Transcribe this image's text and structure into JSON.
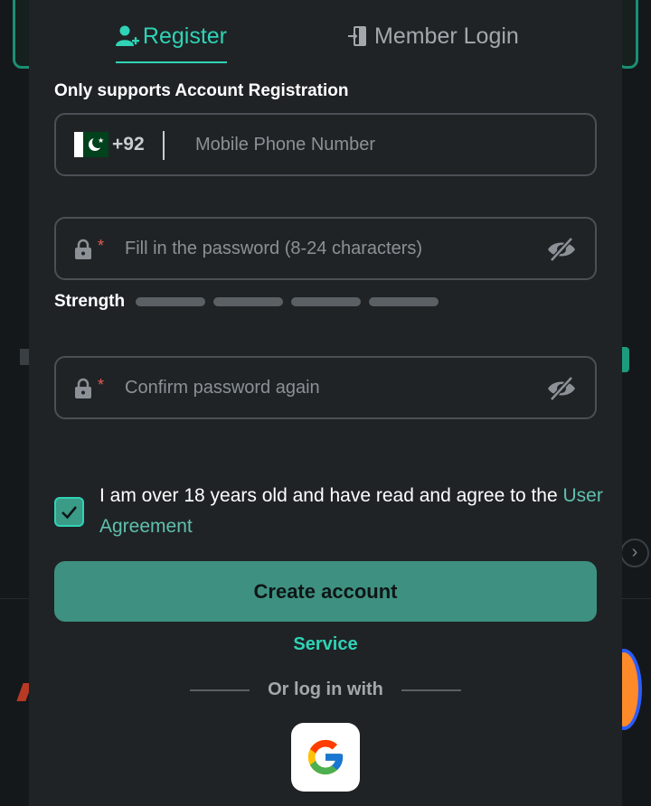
{
  "tabs": {
    "register": "Register",
    "login": "Member Login"
  },
  "note": "Only supports Account Registration",
  "phone": {
    "country_code": "+92",
    "placeholder": "Mobile Phone Number"
  },
  "password": {
    "required_mark": "*",
    "placeholder": "Fill in the password (8-24 characters)"
  },
  "strength": {
    "label": "Strength",
    "levels_filled": 0,
    "levels_total": 4
  },
  "confirm": {
    "required_mark": "*",
    "placeholder": "Confirm password again"
  },
  "agreement": {
    "checked": true,
    "text": "I am over 18 years old and have read and agree to the ",
    "link": "User Agreement"
  },
  "create_button": "Create account",
  "service": "Service",
  "or_login_with": "Or log in with",
  "colors": {
    "accent": "#2fd3b5",
    "button": "#3e9180",
    "panel": "#1f2326"
  },
  "icons": {
    "register": "add-user-icon",
    "login": "door-exit-icon",
    "lock": "lock-icon",
    "eye": "eye-off-icon",
    "google": "google-icon"
  }
}
